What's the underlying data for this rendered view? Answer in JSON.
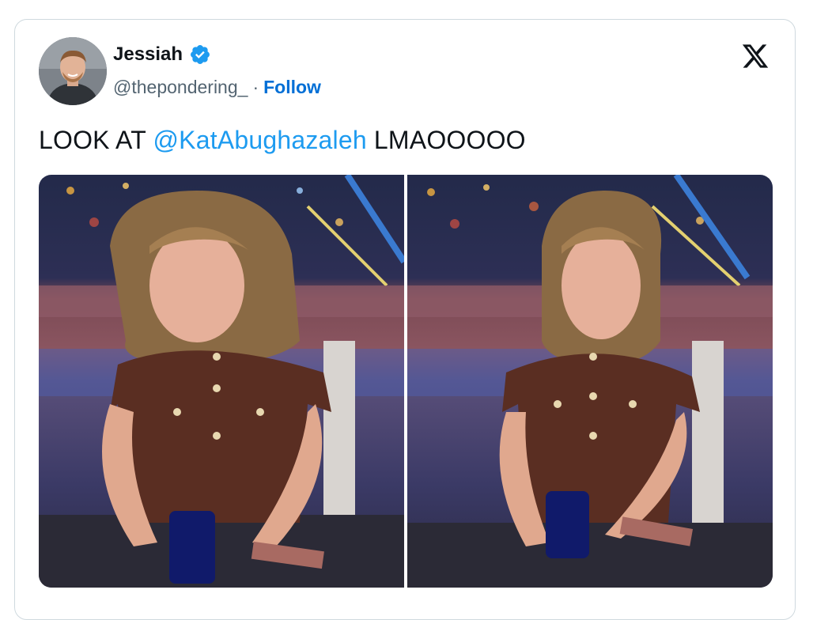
{
  "author": {
    "name": "Jessiah",
    "handle": "@thepondering_",
    "separator": "·",
    "follow_label": "Follow"
  },
  "icons": {
    "verified": "verified-badge-icon",
    "platform": "x-logo-icon"
  },
  "tweet": {
    "text_before": "LOOK AT ",
    "mention": "@KatAbughazaleh",
    "text_after": " LMAOOOOO"
  },
  "colors": {
    "link": "#1d9bf0",
    "follow": "#006fd6",
    "text": "#0f1419",
    "muted": "#536471",
    "border": "#cfd9de"
  }
}
